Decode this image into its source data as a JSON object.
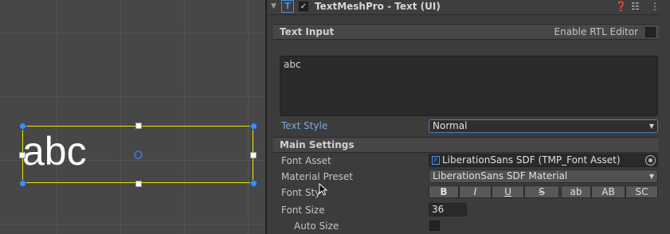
{
  "scene": {
    "text": "abc"
  },
  "component": {
    "title": "TextMeshPro - Text (UI)",
    "icon": "tmp-text-icon",
    "enabled": true,
    "header_icons": [
      "help-icon",
      "preset-icon",
      "more-icon"
    ]
  },
  "text_input": {
    "section_title": "Text Input",
    "rtl_label": "Enable RTL Editor",
    "rtl_enabled": false,
    "value": "abc"
  },
  "text_style": {
    "label": "Text Style",
    "value": "Normal"
  },
  "main_settings": {
    "section_title": "Main Settings",
    "font_asset_label": "Font Asset",
    "font_asset_value": "LiberationSans SDF (TMP_Font Asset)",
    "material_preset_label": "Material Preset",
    "material_preset_value": "LiberationSans SDF Material",
    "font_style_label": "Font Sty",
    "font_style_buttons": [
      "B",
      "I",
      "U",
      "S",
      "ab",
      "AB",
      "SC"
    ],
    "font_size_label": "Font Size",
    "font_size_value": "36",
    "auto_size_label": "Auto Size",
    "auto_size_enabled": false
  },
  "colors": {
    "accent": "#4a90e2",
    "selection": "#e8e800",
    "handle": "#3f8ef5"
  }
}
